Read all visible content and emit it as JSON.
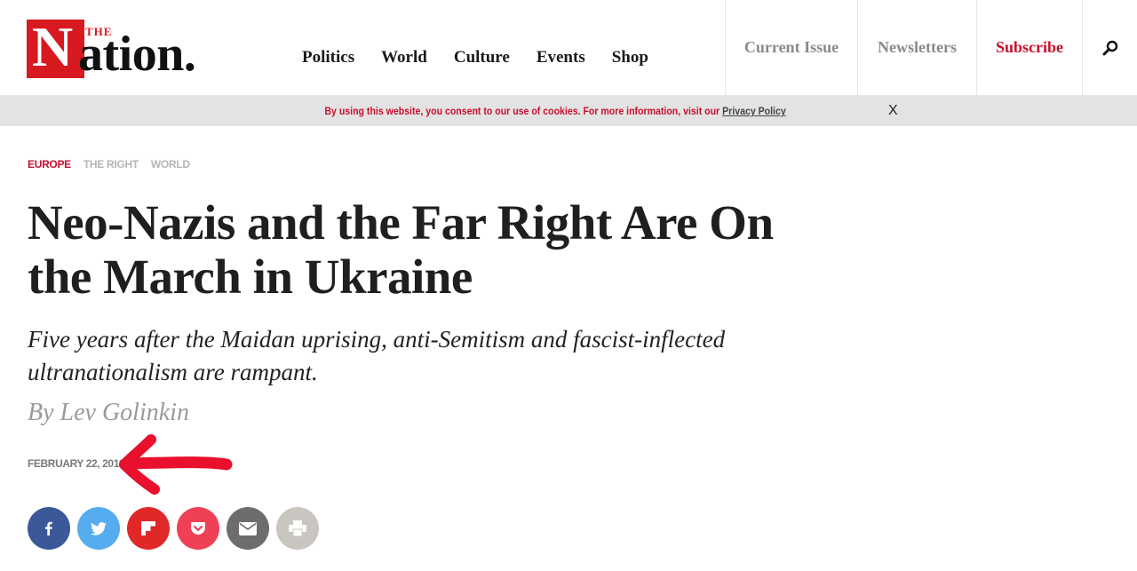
{
  "header": {
    "logo": {
      "the": "THE",
      "n": "N",
      "rest": "ation."
    },
    "nav": [
      "Politics",
      "World",
      "Culture",
      "Events",
      "Shop"
    ],
    "right_nav": {
      "current_issue": "Current Issue",
      "newsletters": "Newsletters",
      "subscribe": "Subscribe"
    }
  },
  "cookie_bar": {
    "text": "By using this website, you consent to our use of cookies. For more information, visit our",
    "link": "Privacy Policy",
    "close": "X"
  },
  "article": {
    "tags": [
      "EUROPE",
      "THE RIGHT",
      "WORLD"
    ],
    "title": "Neo-Nazis and the Far Right Are On the March in Ukraine",
    "subtitle": "Five years after the Maidan uprising, anti-Semitism and fascist-inflected ultranationalism are rampant.",
    "byline": "By Lev Golinkin",
    "date": "FEBRUARY 22, 2019"
  },
  "share_buttons": [
    {
      "name": "facebook",
      "color": "#3b5998"
    },
    {
      "name": "twitter",
      "color": "#55acee"
    },
    {
      "name": "flipboard",
      "color": "#e12828"
    },
    {
      "name": "pocket",
      "color": "#ef4056"
    },
    {
      "name": "email",
      "color": "#6d6d6d"
    },
    {
      "name": "print",
      "color": "#c9c6c1"
    }
  ],
  "colors": {
    "brand_red": "#d71920",
    "subscribe_red": "#c8102e",
    "annotation_red": "#e8102c"
  }
}
